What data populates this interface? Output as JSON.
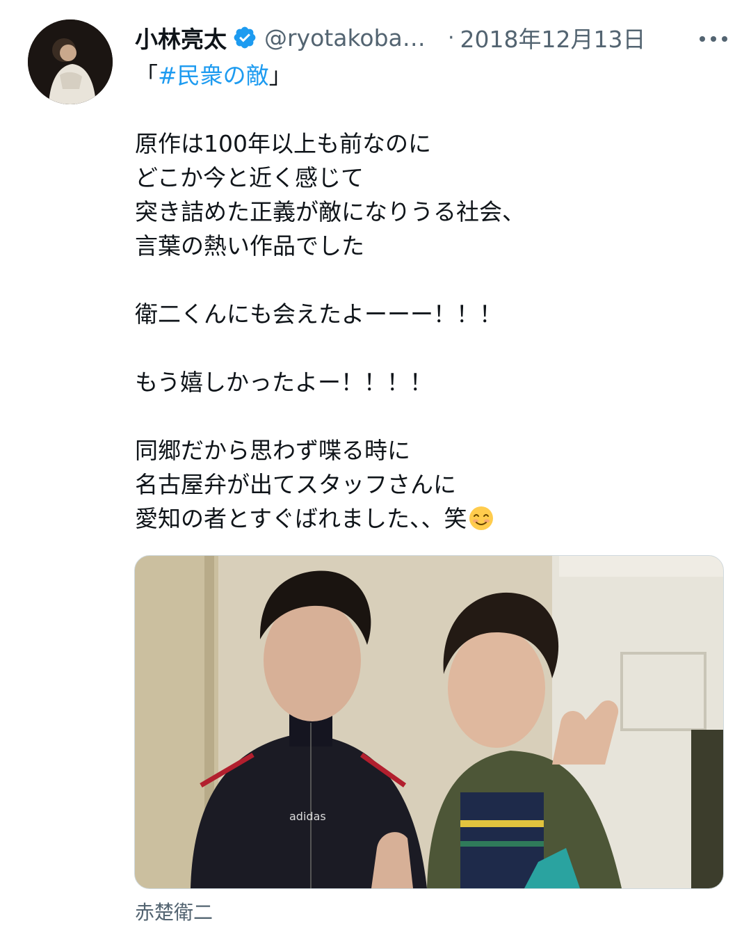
{
  "tweet": {
    "author": {
      "display_name": "小林亮太",
      "handle": "@ryotakobay…",
      "verified": true,
      "avatar_icon": "profile-photo"
    },
    "separator": "·",
    "timestamp": "2018年12月13日",
    "menu_icon": "more-horizontal-icon",
    "text": {
      "line1_open": "「",
      "hashtag": "#民衆の敵",
      "line1_close": "」",
      "lines": [
        "原作は100年以上も前なのに",
        "どこか今と近く感じて",
        "突き詰めた正義が敵になりうる社会、",
        "言葉の熱い作品でした",
        "衛二くんにも会えたよーーー！！！",
        "もう嬉しかったよー！！！！",
        "同郷だから思わず喋る時に",
        "名古屋弁が出てスタッフさんに",
        "愛知の者とすぐばれました、、笑"
      ],
      "emoji": "smiling-face-with-smiling-eyes"
    },
    "media": {
      "type": "photo",
      "caption": "赤楚衛二"
    },
    "colors": {
      "text": "#0f1419",
      "secondary": "#536471",
      "link": "#1d9bf0",
      "verified": "#1d9bf0",
      "border": "#cfd9de"
    }
  }
}
